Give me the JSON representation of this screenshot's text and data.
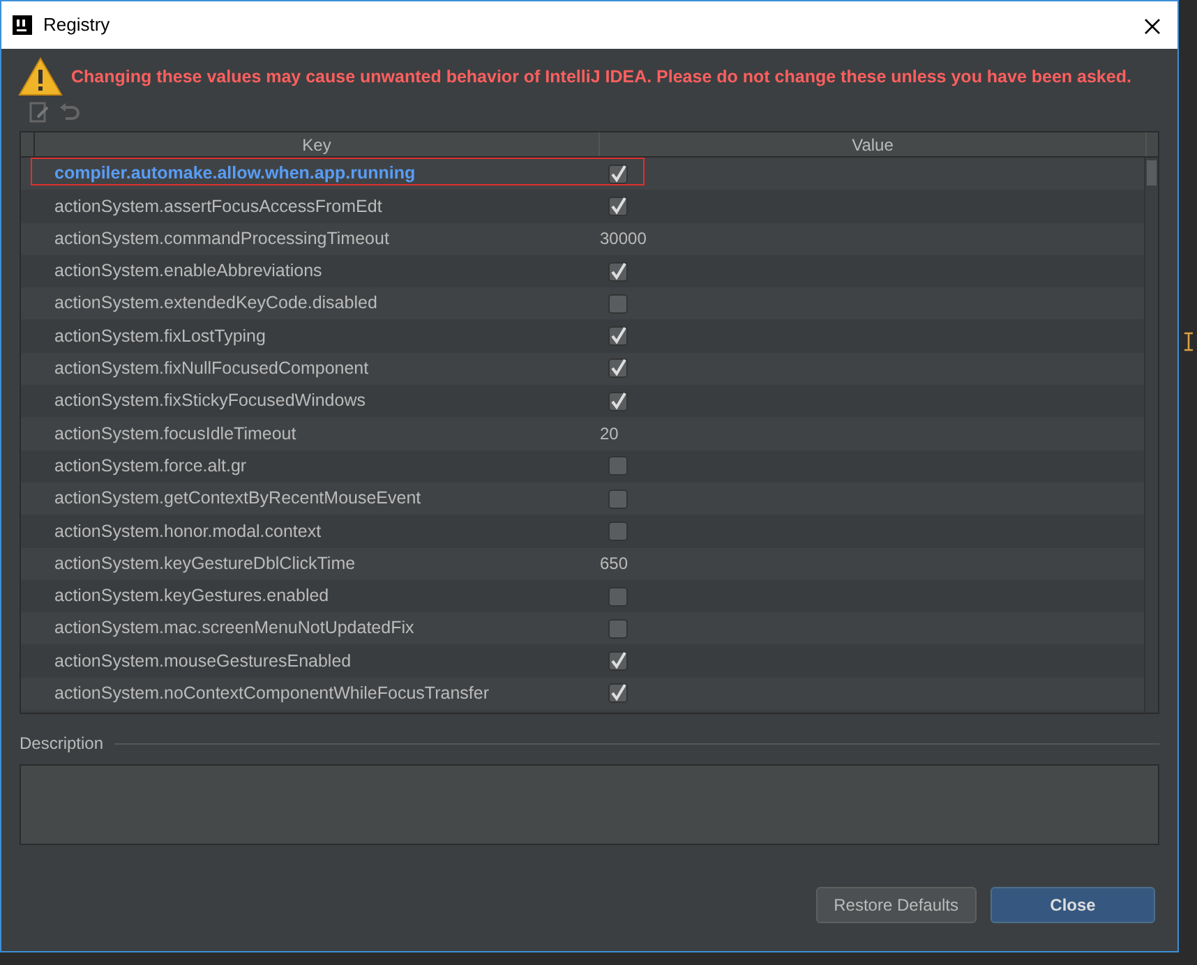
{
  "window": {
    "title": "Registry"
  },
  "warning": "Changing these values may cause unwanted behavior of IntelliJ IDEA. Please do not change these unless you have been asked.",
  "table": {
    "columns": [
      "Key",
      "Value"
    ],
    "rows": [
      {
        "key": "compiler.automake.allow.when.app.running",
        "kind": "checkbox",
        "checked": true,
        "selected": true,
        "outlined": true
      },
      {
        "key": "actionSystem.assertFocusAccessFromEdt",
        "kind": "checkbox",
        "checked": true,
        "selected": false,
        "outlined": false
      },
      {
        "key": "actionSystem.commandProcessingTimeout",
        "kind": "text",
        "value": "30000",
        "selected": false,
        "outlined": false
      },
      {
        "key": "actionSystem.enableAbbreviations",
        "kind": "checkbox",
        "checked": true,
        "selected": false,
        "outlined": false
      },
      {
        "key": "actionSystem.extendedKeyCode.disabled",
        "kind": "checkbox",
        "checked": false,
        "selected": false,
        "outlined": false
      },
      {
        "key": "actionSystem.fixLostTyping",
        "kind": "checkbox",
        "checked": true,
        "selected": false,
        "outlined": false
      },
      {
        "key": "actionSystem.fixNullFocusedComponent",
        "kind": "checkbox",
        "checked": true,
        "selected": false,
        "outlined": false
      },
      {
        "key": "actionSystem.fixStickyFocusedWindows",
        "kind": "checkbox",
        "checked": true,
        "selected": false,
        "outlined": false
      },
      {
        "key": "actionSystem.focusIdleTimeout",
        "kind": "text",
        "value": "20",
        "selected": false,
        "outlined": false
      },
      {
        "key": "actionSystem.force.alt.gr",
        "kind": "checkbox",
        "checked": false,
        "selected": false,
        "outlined": false
      },
      {
        "key": "actionSystem.getContextByRecentMouseEvent",
        "kind": "checkbox",
        "checked": false,
        "selected": false,
        "outlined": false
      },
      {
        "key": "actionSystem.honor.modal.context",
        "kind": "checkbox",
        "checked": false,
        "selected": false,
        "outlined": false
      },
      {
        "key": "actionSystem.keyGestureDblClickTime",
        "kind": "text",
        "value": "650",
        "selected": false,
        "outlined": false
      },
      {
        "key": "actionSystem.keyGestures.enabled",
        "kind": "checkbox",
        "checked": false,
        "selected": false,
        "outlined": false
      },
      {
        "key": "actionSystem.mac.screenMenuNotUpdatedFix",
        "kind": "checkbox",
        "checked": false,
        "selected": false,
        "outlined": false
      },
      {
        "key": "actionSystem.mouseGesturesEnabled",
        "kind": "checkbox",
        "checked": true,
        "selected": false,
        "outlined": false
      },
      {
        "key": "actionSystem.noContextComponentWhileFocusTransfer",
        "kind": "checkbox",
        "checked": true,
        "selected": false,
        "outlined": false
      }
    ]
  },
  "description": {
    "label": "Description"
  },
  "buttons": [
    {
      "label": "Restore Defaults",
      "kind": "secondary"
    },
    {
      "label": "Close",
      "kind": "primary"
    }
  ]
}
